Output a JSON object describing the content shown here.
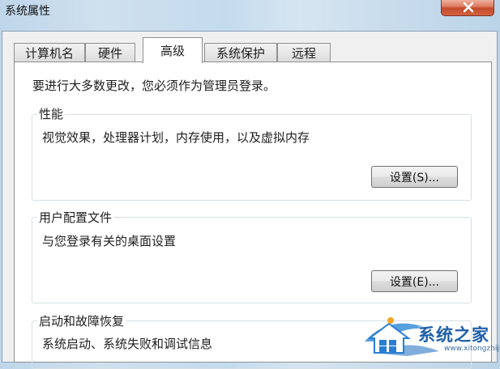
{
  "window": {
    "title": "系统属性"
  },
  "tabs": [
    {
      "label": "计算机名",
      "active": false
    },
    {
      "label": "硬件",
      "active": false
    },
    {
      "label": "高级",
      "active": true
    },
    {
      "label": "系统保护",
      "active": false
    },
    {
      "label": "远程",
      "active": false
    }
  ],
  "advanced": {
    "intro": "要进行大多数更改，您必须作为管理员登录。",
    "performance": {
      "label": "性能",
      "description": "视觉效果，处理器计划，内存使用，以及虚拟内存",
      "button": "设置(S)..."
    },
    "user_profiles": {
      "label": "用户配置文件",
      "description": "与您登录有关的桌面设置",
      "button": "设置(E)..."
    },
    "startup_recovery": {
      "label": "启动和故障恢复",
      "description": "系统启动、系统失败和调试信息"
    }
  },
  "watermark": {
    "text": "系统之家",
    "url": "www.xitongzhijia.net"
  },
  "colors": {
    "close_button": "#c44a2e",
    "watermark": "#1f5fa8"
  }
}
